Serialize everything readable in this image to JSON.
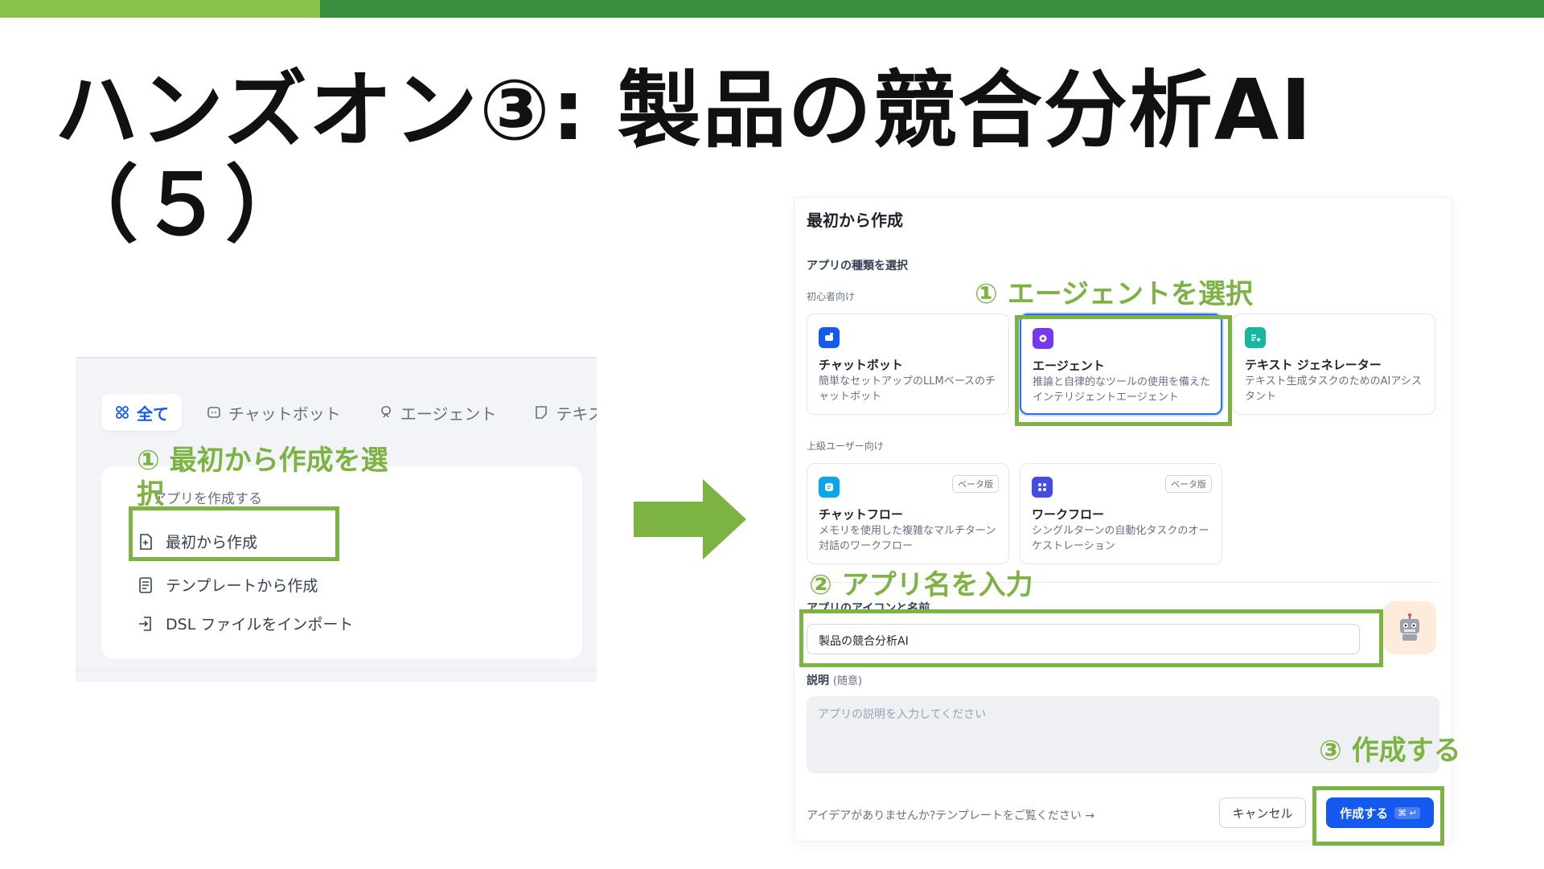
{
  "slide": {
    "title_line1": "ハンズオン③: 製品の競合分析AI",
    "title_line2": "（５）",
    "colors": {
      "accent_green": "#7cb342",
      "bar_dark": "#388e3c",
      "bar_light": "#8bc34a",
      "primary_blue": "#155aef"
    }
  },
  "left_panel": {
    "tabs": [
      {
        "label": "全て",
        "icon": "grid-icon",
        "active": true
      },
      {
        "label": "チャットボット",
        "icon": "chat-icon"
      },
      {
        "label": "エージェント",
        "icon": "agent-icon"
      },
      {
        "label": "テキスト",
        "icon": "note-icon"
      }
    ],
    "card_heading": "アプリを作成する",
    "menu": [
      {
        "label": "最初から作成",
        "icon": "file-plus-icon"
      },
      {
        "label": "テンプレートから作成",
        "icon": "template-icon"
      },
      {
        "label": "DSL ファイルをインポート",
        "icon": "import-icon"
      }
    ],
    "annotation": "① 最初から作成を選択"
  },
  "dialog": {
    "title": "最初から作成",
    "section_app_type": "アプリの種類を選択",
    "beginner_label": "初心者向け",
    "advanced_label": "上級ユーザー向け",
    "beginner_cards": [
      {
        "title": "チャットボット",
        "desc": "簡単なセットアップのLLMベースのチャットボット",
        "icon": "chatbot-icon",
        "icon_color": "#155aef"
      },
      {
        "title": "エージェント",
        "desc": "推論と自律的なツールの使用を備えたインテリジェントエージェント",
        "icon": "agent-icon",
        "icon_color": "#7839ee",
        "selected": true
      },
      {
        "title": "テキスト ジェネレーター",
        "desc": "テキスト生成タスクのためのAIアシスタント",
        "icon": "text-generator-icon",
        "icon_color": "#15b79e"
      }
    ],
    "advanced_cards": [
      {
        "title": "チャットフロー",
        "desc": "メモリを使用した複雑なマルチターン対話のワークフロー",
        "badge": "ベータ版",
        "icon": "chatflow-icon",
        "icon_color": "#0ba5ec"
      },
      {
        "title": "ワークフロー",
        "desc": "シングルターンの自動化タスクのオーケストレーション",
        "badge": "ベータ版",
        "icon": "workflow-icon",
        "icon_color": "#444ce7"
      }
    ],
    "name_label": "アプリのアイコンと名前",
    "name_value": "製品の競合分析AI",
    "app_icon": "robot-icon",
    "desc_label": "説明",
    "desc_optional": "(随意)",
    "desc_placeholder": "アプリの説明を入力してください",
    "footer_link": "アイデアがありませんか?テンプレートをご覧ください →",
    "cancel_label": "キャンセル",
    "create_label": "作成する",
    "create_kbd": "⌘ ↵"
  },
  "annotations": {
    "step1": "① エージェントを選択",
    "step2": "② アプリ名を入力",
    "step3": "③ 作成する"
  }
}
